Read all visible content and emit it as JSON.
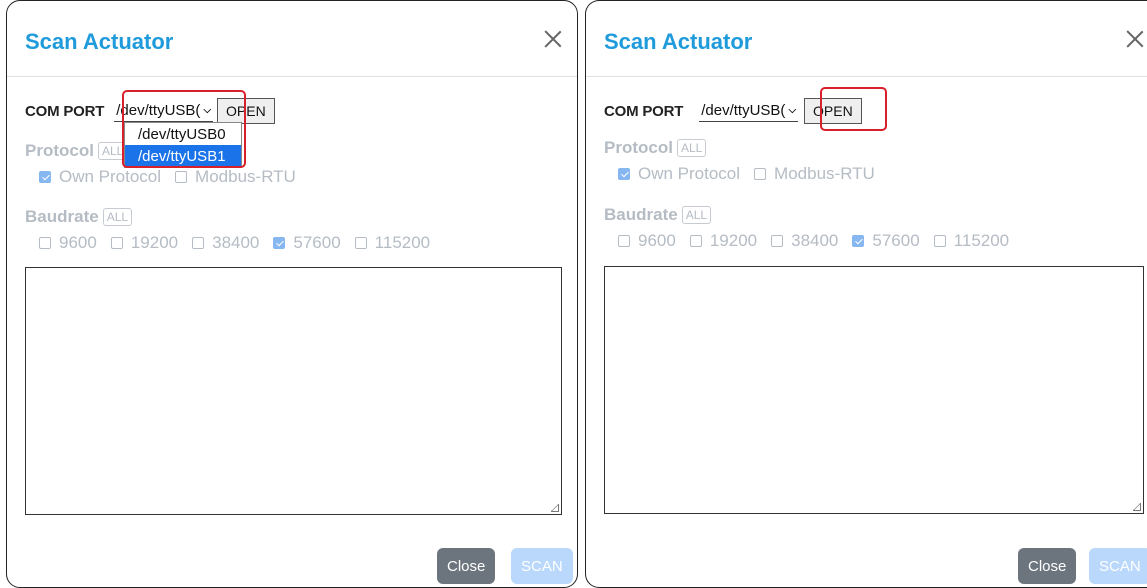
{
  "left_dialog": {
    "title": "Scan Actuator",
    "com_port_label": "COM PORT",
    "com_port_value": "/dev/ttyUSB(",
    "open_label": "OPEN",
    "dropdown_options": [
      "/dev/ttyUSB0",
      "/dev/ttyUSB1"
    ],
    "dropdown_selected": "/dev/ttyUSB1",
    "protocol_label": "Protocol",
    "protocol_all": "ALL",
    "protocol_options": [
      {
        "label": "Own Protocol",
        "checked": true
      },
      {
        "label": "Modbus-RTU",
        "checked": false
      }
    ],
    "baudrate_label": "Baudrate",
    "baudrate_all": "ALL",
    "baudrate_options": [
      {
        "label": "9600",
        "checked": false
      },
      {
        "label": "19200",
        "checked": false
      },
      {
        "label": "38400",
        "checked": false
      },
      {
        "label": "57600",
        "checked": true
      },
      {
        "label": "115200",
        "checked": false
      }
    ],
    "close_label": "Close",
    "scan_label": "SCAN"
  },
  "right_dialog": {
    "title": "Scan Actuator",
    "com_port_label": "COM PORT",
    "com_port_value": "/dev/ttyUSB(",
    "open_label": "OPEN",
    "protocol_label": "Protocol",
    "protocol_all": "ALL",
    "protocol_options": [
      {
        "label": "Own Protocol",
        "checked": true
      },
      {
        "label": "Modbus-RTU",
        "checked": false
      }
    ],
    "baudrate_label": "Baudrate",
    "baudrate_all": "ALL",
    "baudrate_options": [
      {
        "label": "9600",
        "checked": false
      },
      {
        "label": "19200",
        "checked": false
      },
      {
        "label": "38400",
        "checked": false
      },
      {
        "label": "57600",
        "checked": true
      },
      {
        "label": "115200",
        "checked": false
      }
    ],
    "close_label": "Close",
    "scan_label": "SCAN"
  },
  "colors": {
    "title": "#1f9bdb",
    "highlight": "#d8202a",
    "disabled_text": "#b5bcc4",
    "close_button": "#6c757d",
    "scan_button_disabled": "#b9d8fb",
    "dropdown_selected": "#1a73e8"
  }
}
